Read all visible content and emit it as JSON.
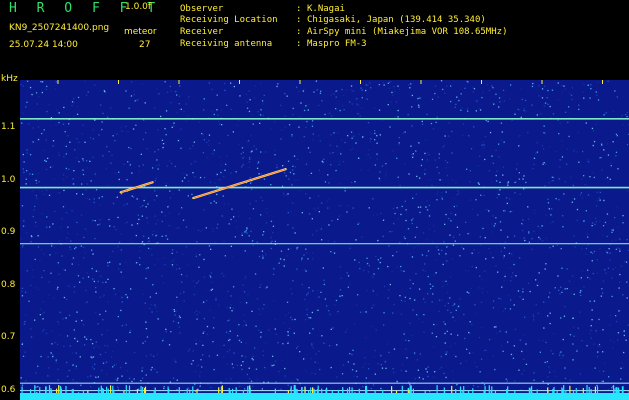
{
  "header": {
    "app_title": "H R O F F T",
    "app_version": "1.0.0f",
    "file_name": "KN9_2507241400.png",
    "meteor_label": "meteor",
    "date_time": "25.07.24 14:00",
    "meteor_count": "27"
  },
  "info": {
    "separator": ":",
    "rows": [
      {
        "label": "Observer",
        "value": "K.Nagai"
      },
      {
        "label": "Receiving Location",
        "value": "Chigasaki, Japan (139.414 35.340)"
      },
      {
        "label": "Receiver",
        "value": "AirSpy mini (Miakejima VOR 108.65MHz)"
      },
      {
        "label": "Receiving antenna",
        "value": "Maspro FM-3"
      }
    ]
  },
  "chart_data": {
    "type": "heatmap",
    "title": "",
    "xlabel": "",
    "ylabel": "kHz",
    "x_ticks": [
      "1401",
      "1402",
      "1403",
      "1404",
      "1405",
      "1406",
      "1407",
      "1408",
      "1409",
      "1410"
    ],
    "y_ticks": [
      "1.1",
      "1.0",
      "0.9",
      "0.8",
      "0.7",
      "0.6"
    ],
    "ylim": [
      0.58,
      1.19
    ],
    "colors": {
      "background": "#0a1a8c",
      "noise": "#4fb3ff",
      "carrier_line": "#8affc8",
      "meteor_echo": "#ffe066",
      "baseline": "#29e6ff"
    },
    "horizontal_lines_khz": [
      1.116,
      0.985,
      0.878,
      0.612,
      0.598
    ],
    "meteor_echoes": [
      {
        "time": "14:02.3",
        "freq_start_khz": 0.976,
        "freq_end_khz": 0.995
      },
      {
        "time": "14:04.0",
        "freq_start_khz": 0.965,
        "freq_end_khz": 1.02
      }
    ]
  }
}
